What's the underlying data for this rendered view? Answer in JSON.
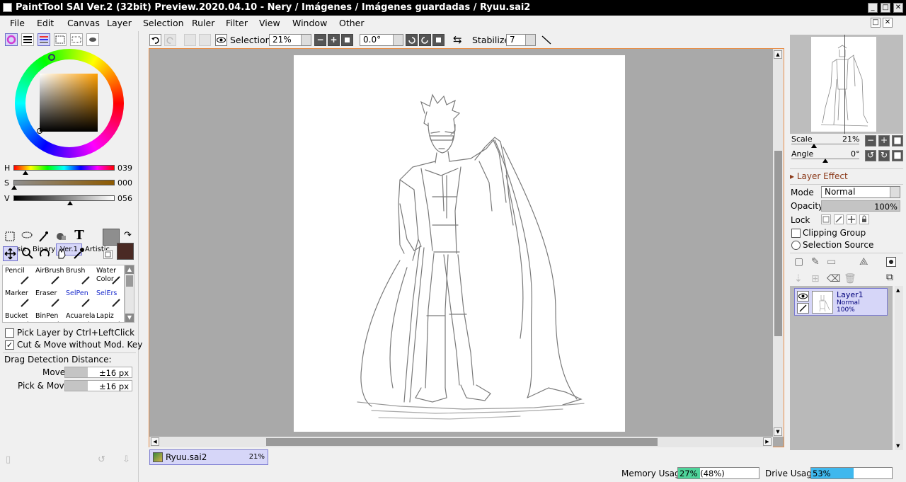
{
  "window": {
    "title": "PaintTool SAI Ver.2 (32bit) Preview.2020.04.10 - Nery / Imágenes / Imágenes guardadas / Ryuu.sai2",
    "controls": [
      "_",
      "□",
      "✕"
    ]
  },
  "menu": [
    "File",
    "Edit",
    "Canvas",
    "Layer",
    "Selection",
    "Ruler",
    "Filter",
    "View",
    "Window",
    "Other"
  ],
  "color_panel": {
    "sliders": [
      {
        "label": "H",
        "value": "039"
      },
      {
        "label": "S",
        "value": "000"
      },
      {
        "label": "V",
        "value": "056"
      }
    ],
    "foreground_color": "#8e8e8e",
    "background_color": "#4a2a24"
  },
  "tool_tabs": [
    "Basic",
    "Binary",
    "Ver.1",
    "Artistic"
  ],
  "selected_tool_tab": "Ver.1",
  "tools": [
    {
      "name": "Pencil",
      "color": "#000"
    },
    {
      "name": "AirBrush",
      "color": "#000"
    },
    {
      "name": "Brush",
      "color": "#000"
    },
    {
      "name": "Water Color",
      "color": "#000"
    },
    {
      "name": "Marker",
      "color": "#000"
    },
    {
      "name": "Eraser",
      "color": "#000"
    },
    {
      "name": "SelPen",
      "color": "#1a2ccc"
    },
    {
      "name": "SelErs",
      "color": "#1a2ccc"
    },
    {
      "name": "Bucket",
      "color": "#000"
    },
    {
      "name": "BinPen",
      "color": "#000"
    },
    {
      "name": "Acuarela",
      "color": "#000"
    },
    {
      "name": "Lapiz",
      "color": "#000"
    }
  ],
  "options": {
    "pick_layer": {
      "label": "Pick Layer by Ctrl+LeftClick",
      "checked": false
    },
    "cut_move": {
      "label": "Cut & Move without Mod. Key",
      "checked": true
    },
    "drag_title": "Drag Detection Distance:",
    "move_label": "Move",
    "move_value": "±16 px",
    "pick_move_label": "Pick & Move",
    "pick_move_value": "±16 px"
  },
  "toolbar": {
    "selection_label": "Selection",
    "zoom": "21%",
    "rotation": "0.0°",
    "stabilizer_label": "Stabilizer",
    "stabilizer_value": "7"
  },
  "document_tab": {
    "name": "Ryuu.sai2",
    "zoom": "21%"
  },
  "navigator": {
    "scale_label": "Scale",
    "scale_value": "21%",
    "angle_label": "Angle",
    "angle_value": "0°"
  },
  "layer_panel": {
    "layer_effect": "Layer Effect",
    "mode_label": "Mode",
    "mode_value": "Normal",
    "opacity_label": "Opacity",
    "opacity_value": "100%",
    "lock_label": "Lock",
    "clipping_group": "Clipping Group",
    "selection_source": "Selection Source"
  },
  "layers": [
    {
      "name": "Layer1",
      "mode": "Normal",
      "opacity": "100%",
      "visible": true
    }
  ],
  "status": {
    "memory_label": "Memory Usage",
    "memory_value": "27% (48%)",
    "memory_fraction": 0.27,
    "drive_label": "Drive Usage",
    "drive_value": "53%",
    "drive_fraction": 0.53
  }
}
